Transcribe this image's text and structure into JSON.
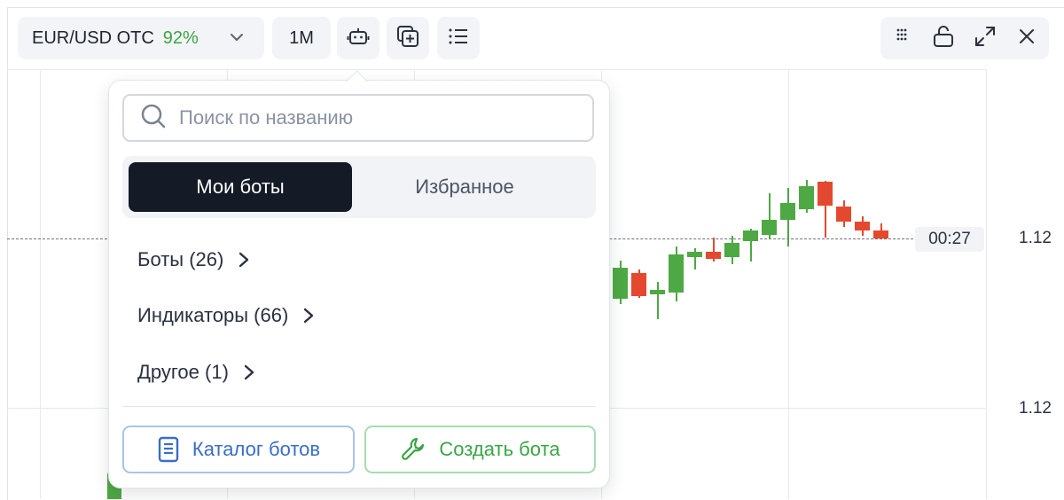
{
  "toolbar": {
    "pair": "EUR/USD OTC",
    "payout": "92%",
    "timeframe": "1M",
    "icons": [
      "chevron-down-icon",
      "robot-icon",
      "add-copy-icon",
      "list-icon",
      "grip-icon",
      "unlock-icon",
      "expand-icon",
      "close-icon"
    ]
  },
  "chart": {
    "timer": "00:27",
    "price_labels": [
      "1.12",
      "1.12"
    ],
    "colors": {
      "up": "#4ea843",
      "down": "#e4492f"
    }
  },
  "popup": {
    "search_placeholder": "Поиск по названию",
    "tabs": [
      {
        "label": "Мои боты",
        "active": true
      },
      {
        "label": "Избранное",
        "active": false
      }
    ],
    "categories": [
      {
        "label": "Боты (26)"
      },
      {
        "label": "Индикаторы (66)"
      },
      {
        "label": "Другое (1)"
      }
    ],
    "buttons": {
      "catalog": "Каталог ботов",
      "create": "Создать бота"
    }
  }
}
